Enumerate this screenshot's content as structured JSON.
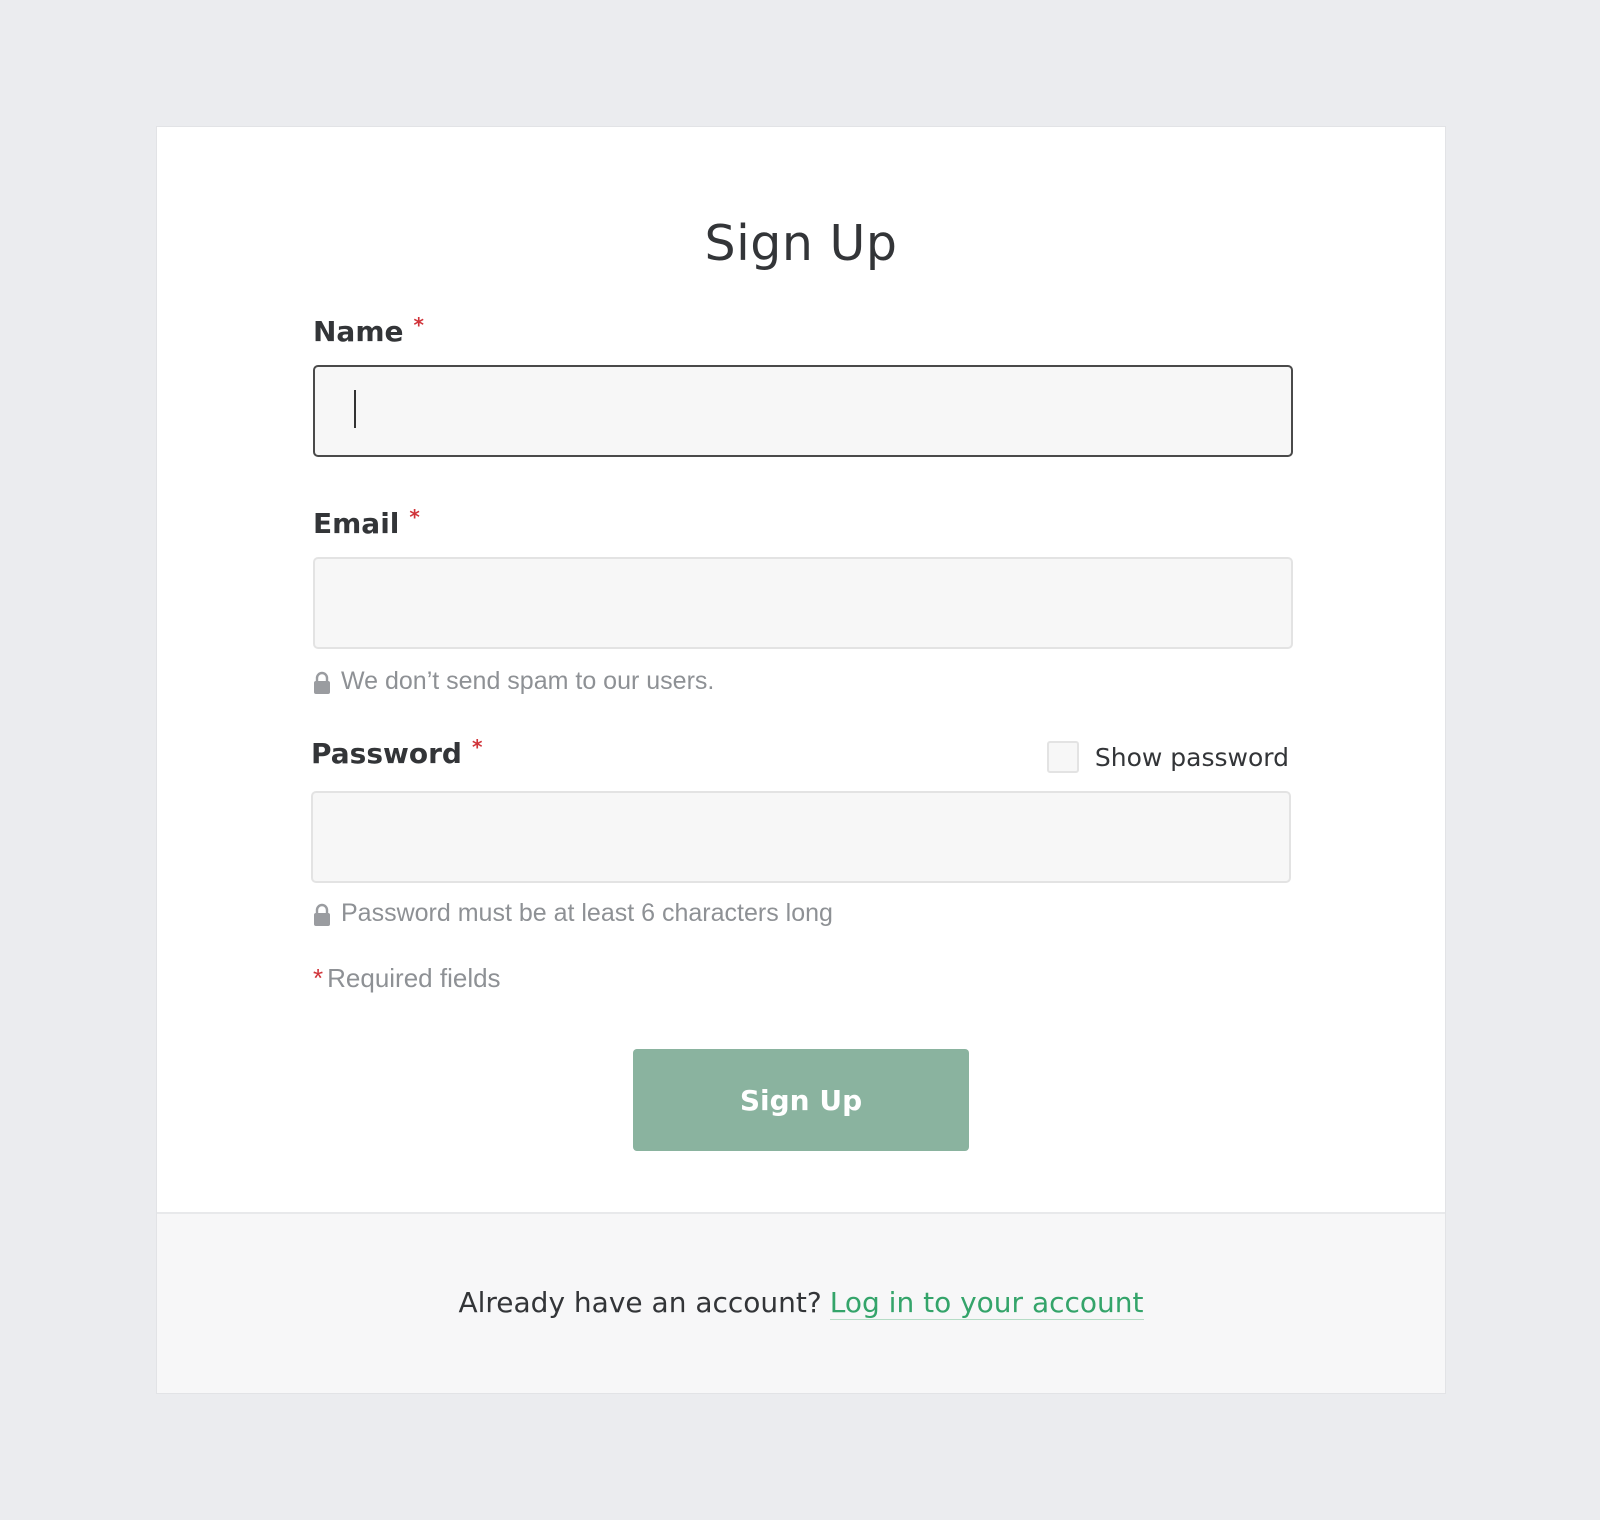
{
  "form": {
    "title": "Sign Up",
    "name_label": "Name",
    "email_label": "Email",
    "password_label": "Password",
    "required_marker": "*",
    "name_value": "",
    "email_value": "",
    "password_value": "",
    "email_hint": "We don’t send spam to our users.",
    "password_hint": "Password must be at least 6 characters long",
    "show_password_label": "Show password",
    "show_password_checked": false,
    "required_note": "Required fields",
    "submit_label": "Sign Up"
  },
  "footer": {
    "prompt": "Already have an account?",
    "login_link": "Log in to your account"
  },
  "colors": {
    "background": "#ebecef",
    "accent": "#34a46a",
    "button": "#8ab39f",
    "required": "#d0343a"
  },
  "icons": {
    "hint_icon": "lock-icon"
  }
}
